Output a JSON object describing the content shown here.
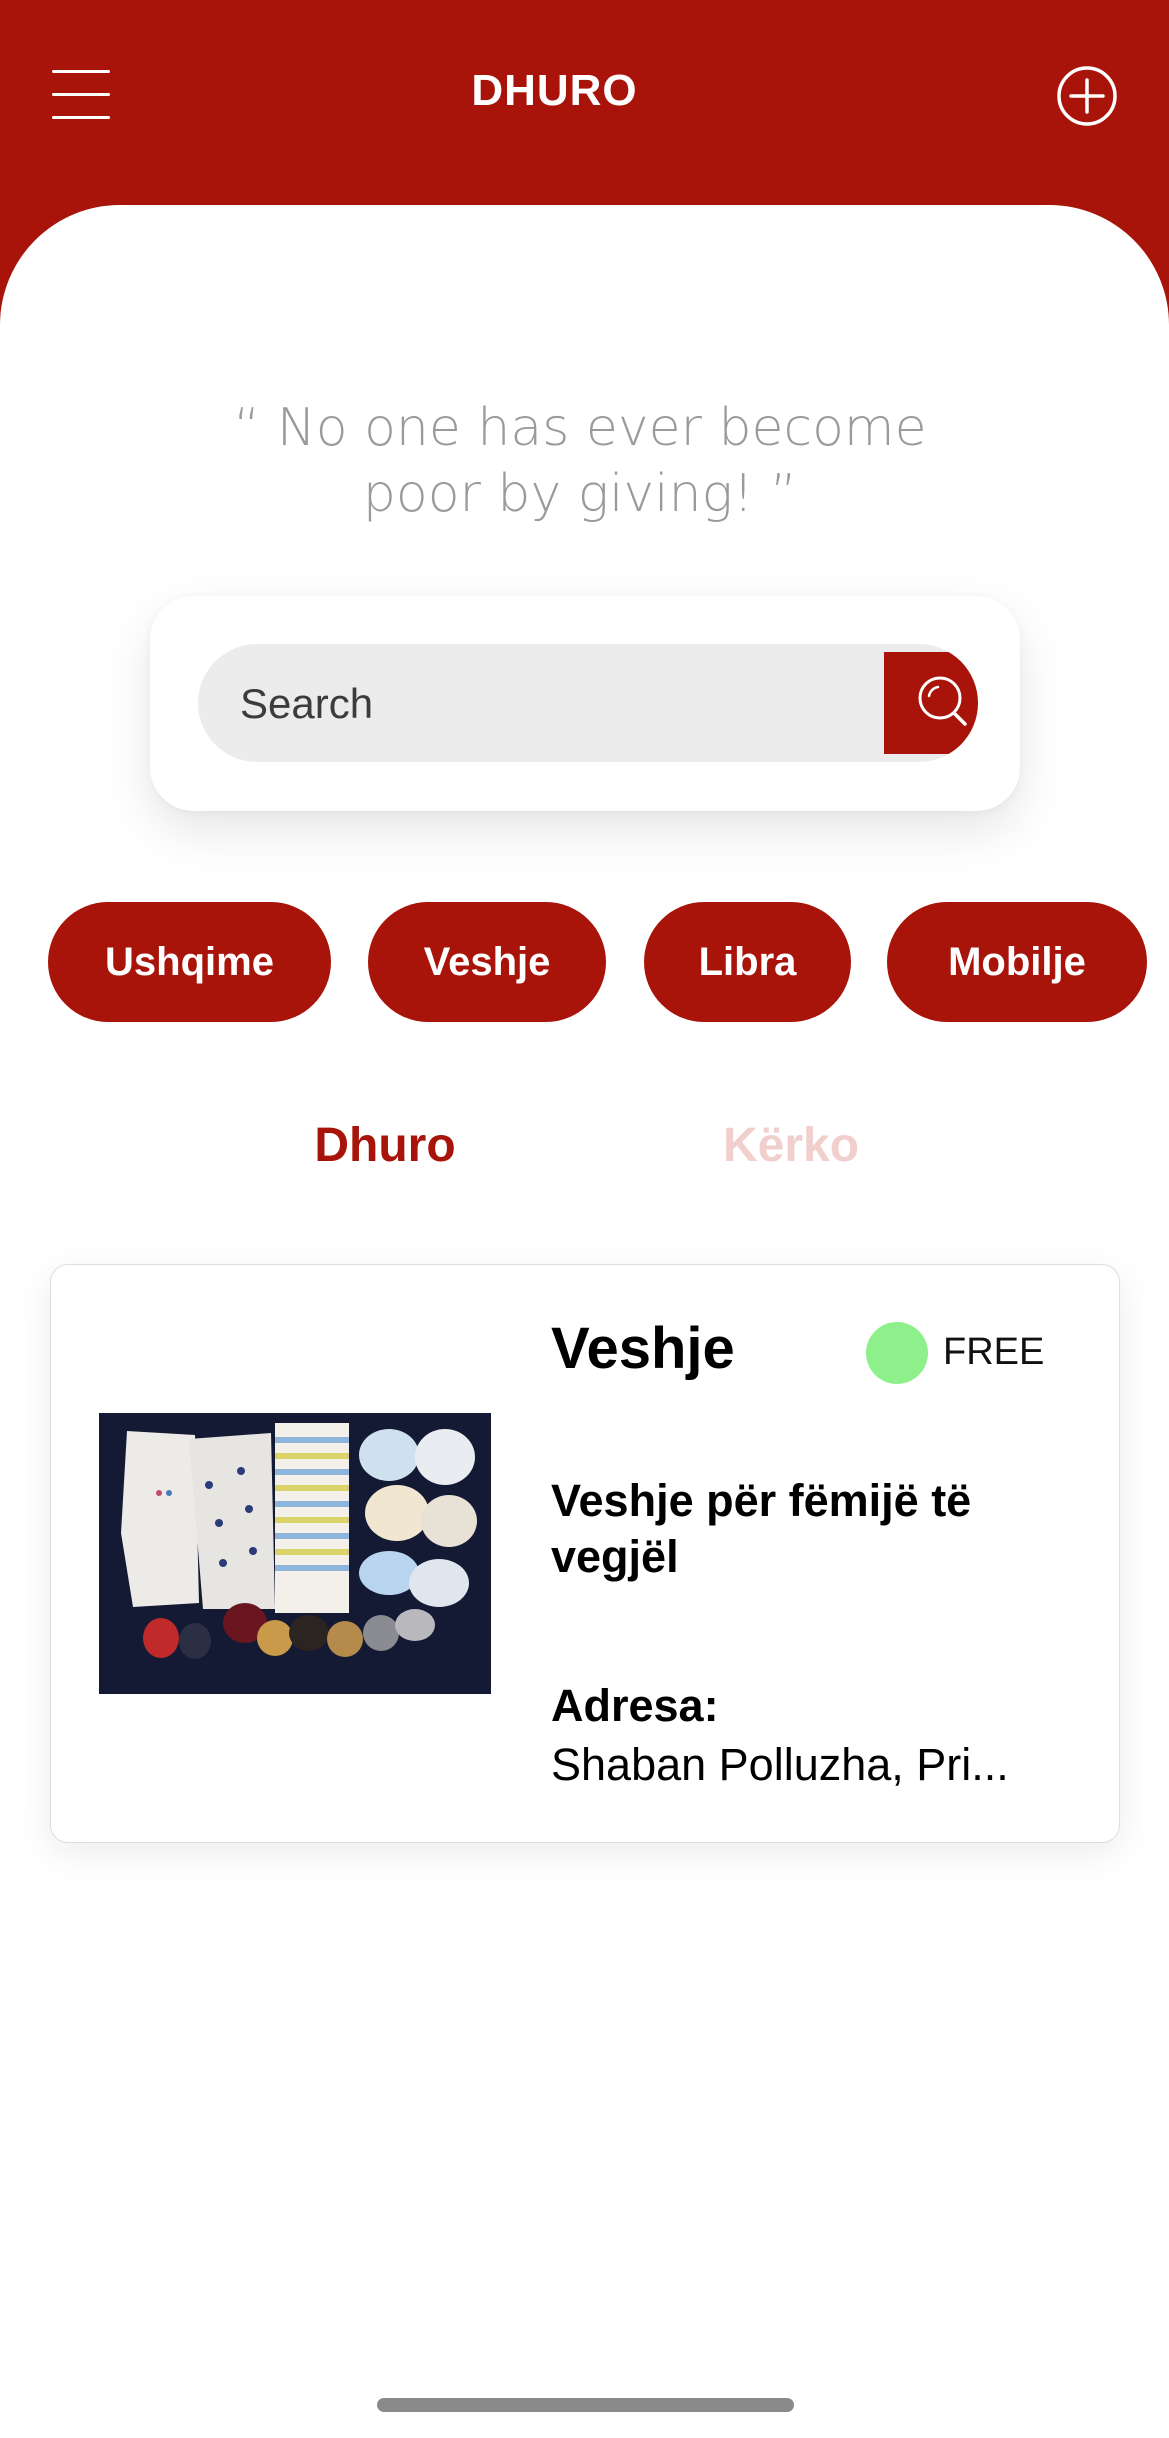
{
  "header": {
    "title": "DHURO",
    "background_color": "#a8140a",
    "menu_icon": "hamburger-menu-icon",
    "add_icon": "plus-circle-icon"
  },
  "quote": "“ No one has ever become poor by giving! ”",
  "search": {
    "placeholder": "Search",
    "value": "",
    "button_icon": "search-icon"
  },
  "categories": [
    {
      "label": "Ushqime"
    },
    {
      "label": "Veshje"
    },
    {
      "label": "Libra"
    },
    {
      "label": "Mobilje"
    }
  ],
  "tabs": [
    {
      "label": "Dhuro",
      "active": true
    },
    {
      "label": "Kërko",
      "active": false
    }
  ],
  "listings": [
    {
      "category": "Veshje",
      "status": "FREE",
      "status_color": "#8ef08b",
      "description": "Veshje për fëmijë të vegjël",
      "address_label": "Adresa:",
      "address": "Shaban Polluzha, Pri..."
    }
  ],
  "colors": {
    "accent": "#a8140a",
    "tab_inactive": "#f1cfcd"
  }
}
